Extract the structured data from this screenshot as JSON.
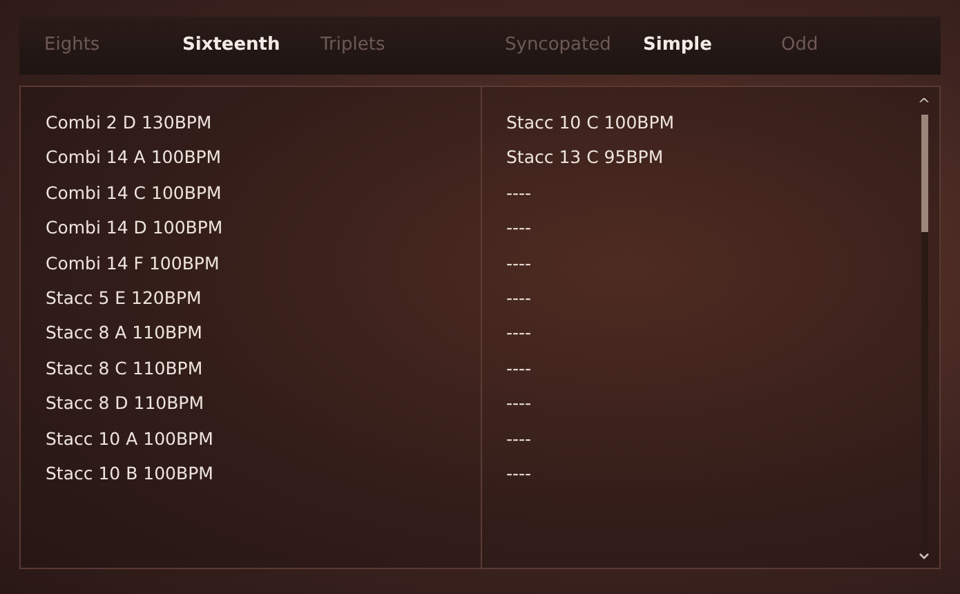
{
  "tab_groups": [
    {
      "tabs": [
        {
          "label": "Eights",
          "selected": false
        },
        {
          "label": "Sixteenth",
          "selected": true
        },
        {
          "label": "Triplets",
          "selected": false
        }
      ]
    },
    {
      "tabs": [
        {
          "label": "Syncopated",
          "selected": false
        },
        {
          "label": "Simple",
          "selected": true
        },
        {
          "label": "Odd",
          "selected": false
        }
      ]
    }
  ],
  "columns": [
    {
      "items": [
        "Combi 2 D 130BPM",
        "Combi 14 A 100BPM",
        "Combi 14 C 100BPM",
        "Combi 14 D 100BPM",
        "Combi 14 F 100BPM",
        "Stacc 5 E 120BPM",
        "Stacc 8 A 110BPM",
        "Stacc 8 C 110BPM",
        "Stacc 8 D 110BPM",
        "Stacc 10 A 100BPM",
        "Stacc 10 B 100BPM"
      ]
    },
    {
      "items": [
        "Stacc 10 C 100BPM",
        "Stacc 13 C 95BPM",
        "----",
        "----",
        "----",
        "----",
        "----",
        "----",
        "----",
        "----",
        "----"
      ]
    }
  ],
  "scroll_up": "^"
}
